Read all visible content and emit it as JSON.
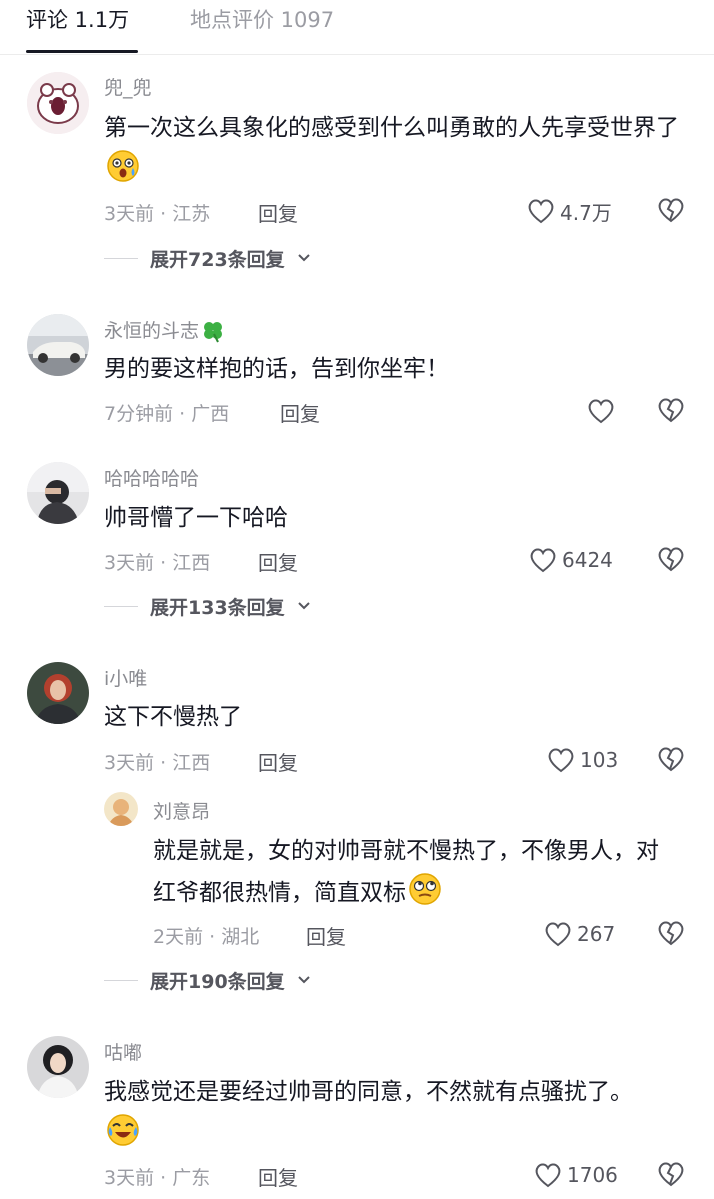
{
  "tabs": {
    "comments": "评论 1.1万",
    "place_reviews": "地点评价 1097"
  },
  "comments": [
    {
      "username": "兜_兜",
      "text": "第一次这么具象化的感受到什么叫勇敢的人先享受世界了",
      "emoji": "surprised-face-emoji",
      "meta": "3天前 · 江苏",
      "reply_label": "回复",
      "likes": "4.7万",
      "expand": "展开723条回复"
    },
    {
      "username": "永恒的斗志",
      "username_badge": "clover-emoji",
      "text": "男的要这样抱的话，告到你坐牢！",
      "meta": "7分钟前 · 广西",
      "reply_label": "回复",
      "likes": ""
    },
    {
      "username": "哈哈哈哈哈",
      "text": "帅哥懵了一下哈哈",
      "meta": "3天前 · 江西",
      "reply_label": "回复",
      "likes": "6424",
      "expand": "展开133条回复"
    },
    {
      "username": "i小唯",
      "text": "这下不慢热了",
      "meta": "3天前 · 江西",
      "reply_label": "回复",
      "likes": "103",
      "reply": {
        "username": "刘意昂",
        "text": "就是就是，女的对帅哥就不慢热了，不像男人，对红爷都很热情，简直双标",
        "emoji": "eye-roll-emoji",
        "meta": "2天前 · 湖北",
        "reply_label": "回复",
        "likes": "267"
      },
      "expand": "展开190条回复"
    },
    {
      "username": "咕嘟",
      "text": "我感觉还是要经过帅哥的同意，不然就有点骚扰了。",
      "emoji": "crying-laughing-emoji",
      "meta": "3天前 · 广东",
      "reply_label": "回复",
      "likes": "1706"
    }
  ]
}
